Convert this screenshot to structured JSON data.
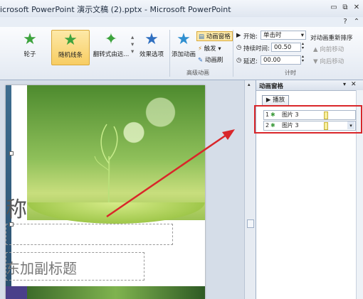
{
  "window": {
    "title": "icrosoft PowerPoint 演示文稿 (2).pptx - Microsoft PowerPoint",
    "controls": [
      "▭",
      "⧉",
      "✕"
    ]
  },
  "ribbon": {
    "effects": [
      {
        "label": "轮子",
        "icon": "star-icon",
        "selected": false
      },
      {
        "label": "随机线条",
        "icon": "star-icon",
        "selected": true
      },
      {
        "label": "翻转式由远...",
        "icon": "star-icon",
        "selected": false
      }
    ],
    "effect_options_label": "效果选项",
    "add_animation_label": "添加动画",
    "animation_pane_label": "动画窗格",
    "trigger_label": "触发",
    "animation_painter_label": "动画刷",
    "advanced_group_label": "高级动画",
    "start_label": "开始:",
    "start_value": "单击时",
    "duration_label": "持续时间:",
    "duration_value": "00.50",
    "delay_label": "延迟:",
    "delay_value": "00.00",
    "timing_group_label": "计时",
    "reorder_label": "对动画重新排序",
    "move_earlier_label": "向前移动",
    "move_later_label": "向后移动"
  },
  "slide": {
    "title_fragment": "称",
    "subtitle_text": "东加副标题"
  },
  "animation_pane": {
    "title": "动画窗格",
    "play_label": "播放",
    "items": [
      {
        "number": "1",
        "name": "图片 3"
      },
      {
        "number": "2",
        "name": "图片 3"
      }
    ]
  },
  "colors": {
    "highlight": "#d9262a",
    "selected_effect": "#f8cd63"
  }
}
